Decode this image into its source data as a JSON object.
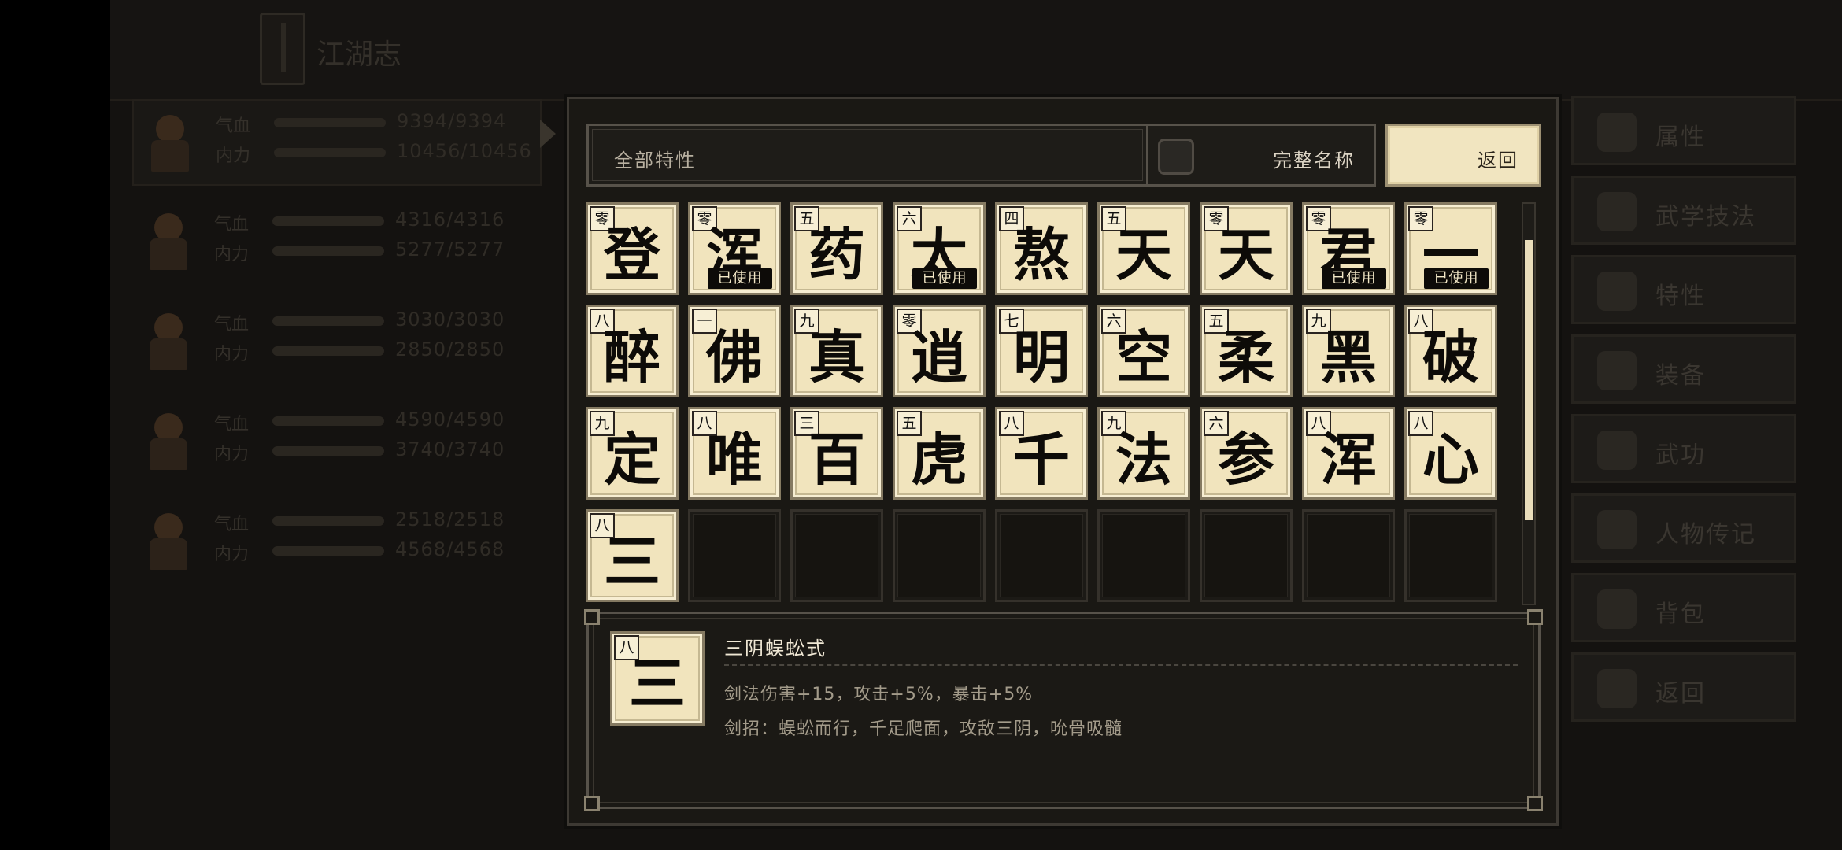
{
  "topbar": {
    "title": "江湖志"
  },
  "party": [
    {
      "hp_label": "气血",
      "mp_label": "内力",
      "hp": "9394/9394",
      "mp": "10456/10456",
      "active": true
    },
    {
      "hp_label": "气血",
      "mp_label": "内力",
      "hp": "4316/4316",
      "mp": "5277/5277",
      "active": false
    },
    {
      "hp_label": "气血",
      "mp_label": "内力",
      "hp": "3030/3030",
      "mp": "2850/2850",
      "active": false
    },
    {
      "hp_label": "气血",
      "mp_label": "内力",
      "hp": "4590/4590",
      "mp": "3740/3740",
      "active": false
    },
    {
      "hp_label": "气血",
      "mp_label": "内力",
      "hp": "2518/2518",
      "mp": "4568/4568",
      "active": false
    }
  ],
  "menu": [
    {
      "label": "属性",
      "icon": "person-icon"
    },
    {
      "label": "武学技法",
      "icon": "martial-skill-icon"
    },
    {
      "label": "特性",
      "icon": "trait-icon"
    },
    {
      "label": "装备",
      "icon": "sword-icon"
    },
    {
      "label": "武功",
      "icon": "scroll-icon"
    },
    {
      "label": "人物传记",
      "icon": "book-icon"
    },
    {
      "label": "背包",
      "icon": "bag-icon"
    },
    {
      "label": "返回",
      "icon": "door-icon"
    }
  ],
  "panel": {
    "filter_label": "全部特性",
    "fullname_label": "完整名称",
    "back_label": "返回",
    "used_label": "已使用",
    "traits": [
      {
        "rank": "零",
        "char": "登",
        "used": false
      },
      {
        "rank": "零",
        "char": "浑",
        "used": true
      },
      {
        "rank": "五",
        "char": "药",
        "used": false
      },
      {
        "rank": "六",
        "char": "太",
        "used": true
      },
      {
        "rank": "四",
        "char": "熬",
        "used": false
      },
      {
        "rank": "五",
        "char": "天",
        "used": false
      },
      {
        "rank": "零",
        "char": "天",
        "used": false
      },
      {
        "rank": "零",
        "char": "君",
        "used": true
      },
      {
        "rank": "零",
        "char": "一",
        "used": true
      },
      {
        "rank": "八",
        "char": "醉",
        "used": false
      },
      {
        "rank": "一",
        "char": "佛",
        "used": false
      },
      {
        "rank": "九",
        "char": "真",
        "used": false
      },
      {
        "rank": "零",
        "char": "逍",
        "used": false
      },
      {
        "rank": "七",
        "char": "明",
        "used": false
      },
      {
        "rank": "六",
        "char": "空",
        "used": false
      },
      {
        "rank": "五",
        "char": "柔",
        "used": false
      },
      {
        "rank": "九",
        "char": "黑",
        "used": false
      },
      {
        "rank": "八",
        "char": "破",
        "used": false
      },
      {
        "rank": "九",
        "char": "定",
        "used": false
      },
      {
        "rank": "八",
        "char": "唯",
        "used": false
      },
      {
        "rank": "三",
        "char": "百",
        "used": false
      },
      {
        "rank": "五",
        "char": "虎",
        "used": false
      },
      {
        "rank": "八",
        "char": "千",
        "used": false
      },
      {
        "rank": "九",
        "char": "法",
        "used": false
      },
      {
        "rank": "六",
        "char": "参",
        "used": false
      },
      {
        "rank": "八",
        "char": "浑",
        "used": false
      },
      {
        "rank": "八",
        "char": "心",
        "used": false
      },
      {
        "rank": "八",
        "char": "三",
        "used": false
      }
    ],
    "total_slots": 36,
    "scroll_position": 0.3
  },
  "detail": {
    "rank": "八",
    "char": "三",
    "name": "三阴蜈蚣式",
    "effect": "剑法伤害+15，攻击+5%，暴击+5%",
    "description": "剑招：蜈蚣而行，千足爬面，攻敌三阴，吮骨吸髓"
  }
}
